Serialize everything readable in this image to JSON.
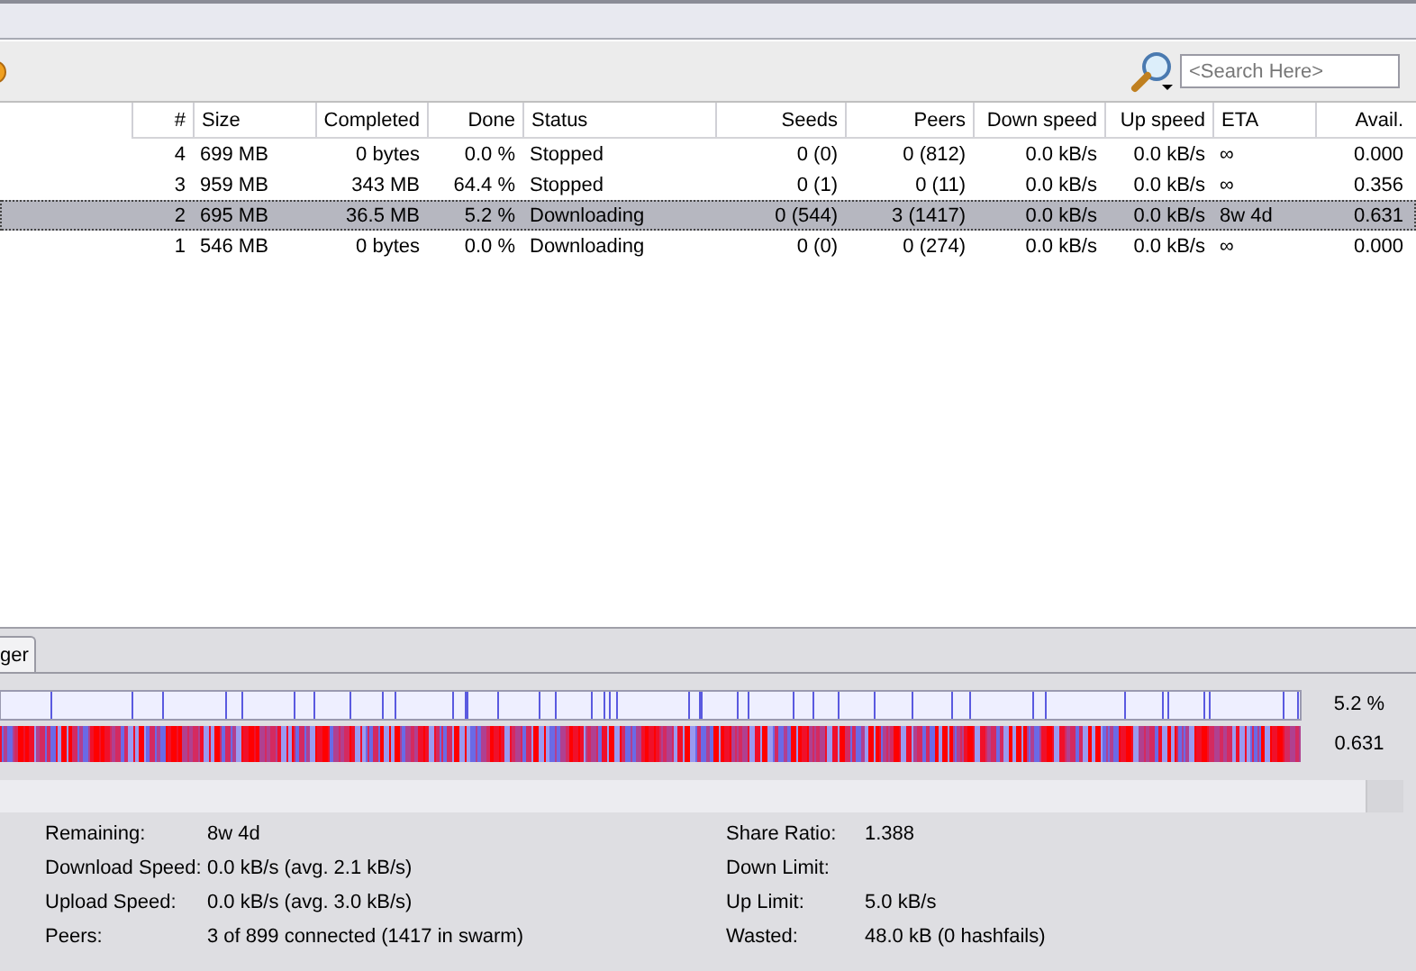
{
  "search": {
    "placeholder": "<Search Here>"
  },
  "table": {
    "columns": [
      "#",
      "Size",
      "Completed",
      "Done",
      "Status",
      "Seeds",
      "Peers",
      "Down speed",
      "Up speed",
      "ETA",
      "Avail."
    ],
    "rows": [
      {
        "selected": false,
        "cells": [
          "4",
          "699 MB",
          "0 bytes",
          "0.0 %",
          "Stopped",
          "0 (0)",
          "0 (812)",
          "0.0 kB/s",
          "0.0 kB/s",
          "∞",
          "0.000"
        ]
      },
      {
        "selected": false,
        "cells": [
          "3",
          "959 MB",
          "343 MB",
          "64.4 %",
          "Stopped",
          "0 (1)",
          "0 (11)",
          "0.0 kB/s",
          "0.0 kB/s",
          "∞",
          "0.356"
        ]
      },
      {
        "selected": true,
        "cells": [
          "2",
          "695 MB",
          "36.5 MB",
          "5.2 %",
          "Downloading",
          "0 (544)",
          "3 (1417)",
          "0.0 kB/s",
          "0.0 kB/s",
          "8w 4d",
          "0.631"
        ]
      },
      {
        "selected": false,
        "cells": [
          "1",
          "546 MB",
          "0 bytes",
          "0.0 %",
          "Downloading",
          "0 (0)",
          "0 (274)",
          "0.0 kB/s",
          "0.0 kB/s",
          "∞",
          "0.000"
        ]
      }
    ]
  },
  "detail_tab": {
    "label": "ger",
    "selected": true
  },
  "pieces": {
    "reading": "5.2 %"
  },
  "availability": {
    "reading": "0.631"
  },
  "info": {
    "left": [
      {
        "label": "Remaining:",
        "value": "8w 4d"
      },
      {
        "label": "Download Speed:",
        "value": "0.0 kB/s (avg. 2.1 kB/s)"
      },
      {
        "label": "Upload Speed:",
        "value": "0.0 kB/s (avg. 3.0 kB/s)"
      },
      {
        "label": "Peers:",
        "value": "3 of 899 connected (1417 in swarm)"
      }
    ],
    "right": [
      {
        "label": "Share Ratio:",
        "value": "1.388"
      },
      {
        "label": "Down Limit:"
      },
      {
        "label": "Up Limit:",
        "value": "5.0 kB/s"
      },
      {
        "label": "Wasted:",
        "value": "48.0 kB (0 hashfails)"
      }
    ]
  }
}
